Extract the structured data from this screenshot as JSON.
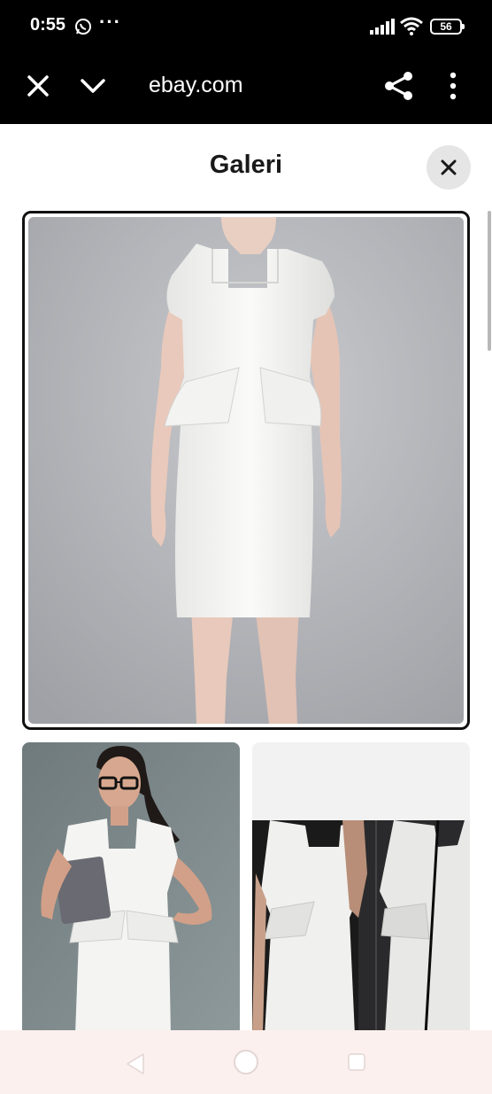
{
  "status_bar": {
    "time": "0:55",
    "dots": "···",
    "battery": "56",
    "icons": [
      "whatsapp-icon",
      "signal-icon",
      "wifi-icon",
      "battery-icon"
    ]
  },
  "browser": {
    "url": "ebay.com",
    "icons": [
      "close-icon",
      "chevron-down-icon",
      "share-icon",
      "more-vertical-icon"
    ]
  },
  "gallery": {
    "title": "Galeri",
    "close_icon": "close-icon",
    "images": [
      {
        "subject": "white peplum dress on model, gray background",
        "selected": true
      },
      {
        "subject": "woman in white peplum dress with glasses holding tablet",
        "selected": false
      },
      {
        "subject": "white peplum dress reflected in mirror",
        "selected": false
      }
    ]
  },
  "nav_bar": {
    "icons": [
      "back-icon",
      "home-icon",
      "recents-icon"
    ]
  },
  "colors": {
    "bar_background": "#000000",
    "bar_text": "#ffffff",
    "title_text": "#191919",
    "selected_border": "#111111",
    "close_button_bg": "#e5e5e5",
    "nav_bar_bg": "#fcf0ee"
  }
}
